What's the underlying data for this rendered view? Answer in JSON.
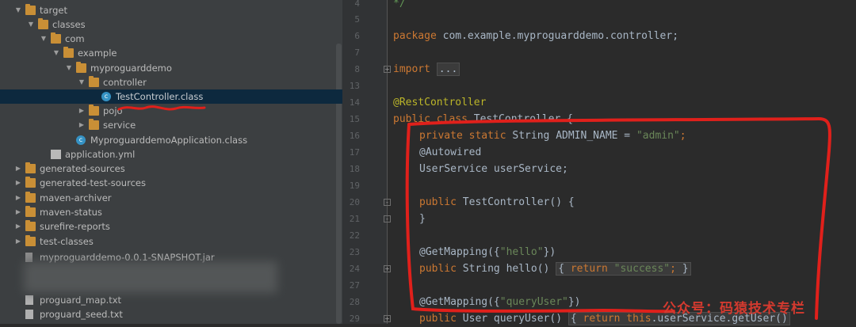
{
  "project_tree": {
    "items": [
      {
        "label": "target",
        "type": "folder",
        "expanded": true
      },
      {
        "label": "classes",
        "type": "folder",
        "expanded": true
      },
      {
        "label": "com",
        "type": "folder",
        "expanded": true
      },
      {
        "label": "example",
        "type": "folder",
        "expanded": true
      },
      {
        "label": "myproguarddemo",
        "type": "folder",
        "expanded": true
      },
      {
        "label": "controller",
        "type": "folder",
        "expanded": true
      },
      {
        "label": "TestController.class",
        "type": "class",
        "selected": true
      },
      {
        "label": "pojo",
        "type": "folder",
        "expanded": false
      },
      {
        "label": "service",
        "type": "folder",
        "expanded": false
      },
      {
        "label": "MyproguarddemoApplication.class",
        "type": "class"
      },
      {
        "label": "application.yml",
        "type": "yml"
      },
      {
        "label": "generated-sources",
        "type": "folder",
        "expanded": false
      },
      {
        "label": "generated-test-sources",
        "type": "folder",
        "expanded": false
      },
      {
        "label": "maven-archiver",
        "type": "folder",
        "expanded": false
      },
      {
        "label": "maven-status",
        "type": "folder",
        "expanded": false
      },
      {
        "label": "surefire-reports",
        "type": "folder",
        "expanded": false
      },
      {
        "label": "test-classes",
        "type": "folder",
        "expanded": false
      },
      {
        "label": "myproguarddemo-0.0.1-SNAPSHOT.jar",
        "type": "jar"
      },
      {
        "label": "proguard_map.txt",
        "type": "txt"
      },
      {
        "label": "proguard_seed.txt",
        "type": "txt"
      }
    ]
  },
  "editor": {
    "line_numbers": [
      "4",
      "5",
      "6",
      "7",
      "8",
      "13",
      "14",
      "15",
      "16",
      "17",
      "18",
      "19",
      "20",
      "21",
      "22",
      "23",
      "24",
      "27",
      "28",
      "29"
    ],
    "lines": {
      "l4": "*/",
      "l6_kw": "package",
      "l6_rest": " com.example.myproguarddemo.controller;",
      "l8_kw": "import",
      "l8_fold": "...",
      "l14": "@RestController",
      "l15_kw": "public class",
      "l15_rest": " TestController {",
      "l16_kw": "private static",
      "l16_mid": " String ",
      "l16_field": "ADMIN_NAME",
      "l16_eq": " = ",
      "l16_str": "\"admin\"",
      "l16_end": ";",
      "l17": "@Autowired",
      "l18": "UserService userService;",
      "l20_kw": "public",
      "l20_rest": " TestController() {",
      "l21": "}",
      "l23_an": "@GetMapping",
      "l23_open": "({",
      "l23_str": "\"hello\"",
      "l23_close": "})",
      "l24_kw": "public",
      "l24_mid": " String hello() ",
      "l24_fold_kw": "return",
      "l24_fold_str": "\"success\"",
      "l27_an": "@GetMapping",
      "l27_open": "({",
      "l27_str": "\"queryUser\"",
      "l27_close": "})",
      "l28_kw": "public",
      "l28_mid": " User queryUser() ",
      "l28_fold_kw": "return this",
      "l28_fold_rest": ".userService.getUser()"
    }
  },
  "watermark": "公众号：码猿技术专栏",
  "colors": {
    "keyword": "#cc7832",
    "string": "#6a8759",
    "annotation": "#bbb529",
    "highlight_red": "#e0201b"
  }
}
